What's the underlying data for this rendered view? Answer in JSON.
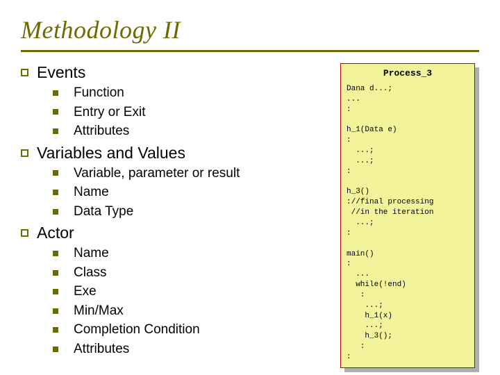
{
  "title": "Methodology II",
  "sections": [
    {
      "title": "Events",
      "items": [
        "Function",
        "Entry or Exit",
        "Attributes"
      ]
    },
    {
      "title": "Variables and Values",
      "items": [
        "Variable, parameter or result",
        "Name",
        "Data Type"
      ]
    },
    {
      "title": "Actor",
      "items": [
        "Name",
        "Class",
        "Exe",
        "Min/Max",
        "Completion Condition",
        "Attributes"
      ]
    }
  ],
  "codePanel": {
    "title": "Process_3",
    "code": "Dana d...;\n...\n:\n\nh_1(Data e)\n:\n  ...;\n  ...;\n:\n\nh_3()\n://final processing\n //in the iteration\n  ...;\n:\n\nmain()\n:\n  ...\n  while(!end)\n   :\n    ...;\n    h_1(x)\n    ...;\n    h_3();\n   :\n:\n"
  }
}
